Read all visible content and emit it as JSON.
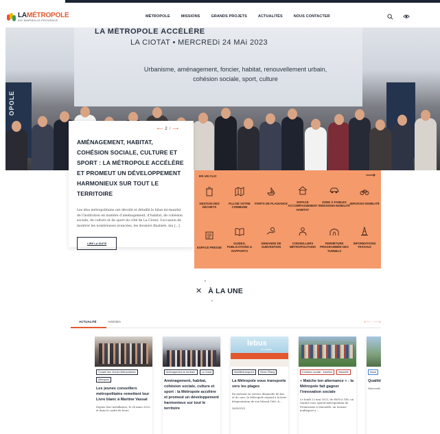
{
  "brand": {
    "logo_la": "LA",
    "logo_metropole": "MÉTROPOLE",
    "logo_sub": "AIX-MARSEILLE-PROVENCE",
    "colors": {
      "accent": "#e4572e",
      "dark": "#1b2432",
      "oneclick_bg": "#f49a6b"
    }
  },
  "nav": {
    "items": [
      "MÉTROPOLE",
      "MISSIONS",
      "GRANDS PROJETS",
      "ACTUALITÉS",
      "NOUS CONTACTER"
    ],
    "icons": [
      "search-icon",
      "eye-icon"
    ]
  },
  "hero": {
    "screen_title": "LA MÉTROPOLE ACCÉLÈRE",
    "screen_subtitle": "LA CIOTAT • MERCREDi 24 MAi 2023",
    "screen_body": "Urbanisme, aménagement, foncier, habitat, renouvellement urbain, cohésion sociale, sport, culture",
    "side_text": "OPOLE",
    "pager_current": "2",
    "pager_sep": "/",
    "title": "AMÉNAGEMENT, HABITAT, COHÉSION SOCIALE, CULTURE ET SPORT : LA MÉTROPOLE ACCÉLÈRE ET PROMEUT UN DÉVELOPPEMENT HARMONIEUX SUR TOUT LE TERRITOIRE",
    "text": "Les élus métropolitains ont dévoilé et détaillé le bilan mi-mandat de l’institution en matière d’aménagement, d’habitat, de cohésion sociale, de culture et de sport du côté de La Ciotat. L’occasion de montrer les nombreuses avancées, les dossiers finalisés, ma [...]",
    "button": "LIRE LA SUITE"
  },
  "oneclick": {
    "label": "EN UN CLIC",
    "items": [
      {
        "label": "GESTION DES DÉCHETS",
        "icon": "trash-bin-icon"
      },
      {
        "label": "PLU DE VOTRE COMMUNE",
        "icon": "map-icon"
      },
      {
        "label": "PORTS DE PLAISANCE",
        "icon": "boat-icon"
      },
      {
        "label": "ESPACE ACCOMPAGNEMENT HABITAT",
        "icon": "house-icon"
      },
      {
        "label": "ZONE À FAIBLES ÉMISSIONS-MOBILITÉ",
        "icon": "car-icon"
      },
      {
        "label": "SERVICES MOBILITÉ",
        "icon": "bike-icon"
      },
      {
        "label": "ESPACE PRESSE",
        "icon": "newspaper-icon"
      },
      {
        "label": "GUIDES, PUBLICATIONS & RAPPORTS",
        "icon": "book-icon"
      },
      {
        "label": "DEMANDE DE SUBVENTION",
        "icon": "hand-coin-icon"
      },
      {
        "label": "CONSEILLERS MÉTROPOLITAINS",
        "icon": "people-icon"
      },
      {
        "label": "FERMETURE PROGRAMMÉE DES TUNNELS",
        "icon": "tunnel-icon"
      },
      {
        "label": "INFORMATIONS TRAVAUX",
        "icon": "cone-icon"
      }
    ]
  },
  "une": {
    "title": "À LA UNE"
  },
  "tabs": {
    "items": [
      "ACTUALITÉ",
      "AGENDA"
    ],
    "active": "ACTUALITÉ"
  },
  "cards": [
    {
      "tags": [
        "Conseil des Jeunes Métropolitains",
        "Métropole"
      ],
      "title": "Les jeunes conseillers métropolitains remettent leur Livre blanc à Martine Vassal",
      "text": "Depuis leur installation, le 24 mars 2022, et dans le cadre de leurs"
    },
    {
      "tags": [
        "Aménagement du territoire",
        "La Ciotat"
      ],
      "title": "Aménagement, habitat, cohésion sociale, culture et sport : la Métropole accélère et promeut un développement harmonieux sur tout le territoire",
      "text": ""
    },
    {
      "img_brand": "lebus",
      "img_slogan": "un plaisir",
      "tags": [
        "Mobilité/transports",
        "Berre-l'Étang"
      ],
      "title": "La Métropole vous transporte vers les plages",
      "text": "En mettant en service dimanche de bus et de cars, la Métropole répond à la forte fréquentation de son littoral l'été. À...",
      "date": "26/05/2023"
    },
    {
      "tags": [
        "Cohésion sociale - Insertion",
        "Marseille"
      ],
      "title": "« Matche ton alternance » : la Métropole fait gagner l'innovation sociale",
      "text": "Le lundi 22 mai 2023, de 8h30 à 16h, un rendez-vous sportif métropolitain de Promosiens à Marseille, un tournoi multisport a ..."
    },
    {
      "tags": [
        "Assai"
      ],
      "title": "Qualité « pour l d'épura",
      "text": "Mercredi prési Marseille nouvelle e"
    }
  ]
}
